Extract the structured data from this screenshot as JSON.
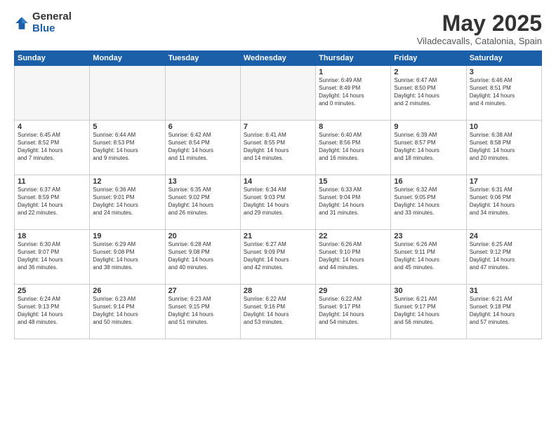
{
  "logo": {
    "general": "General",
    "blue": "Blue"
  },
  "title": "May 2025",
  "subtitle": "Viladecavalls, Catalonia, Spain",
  "days_header": [
    "Sunday",
    "Monday",
    "Tuesday",
    "Wednesday",
    "Thursday",
    "Friday",
    "Saturday"
  ],
  "weeks": [
    [
      {
        "num": "",
        "info": ""
      },
      {
        "num": "",
        "info": ""
      },
      {
        "num": "",
        "info": ""
      },
      {
        "num": "",
        "info": ""
      },
      {
        "num": "1",
        "info": "Sunrise: 6:49 AM\nSunset: 8:49 PM\nDaylight: 14 hours\nand 0 minutes."
      },
      {
        "num": "2",
        "info": "Sunrise: 6:47 AM\nSunset: 8:50 PM\nDaylight: 14 hours\nand 2 minutes."
      },
      {
        "num": "3",
        "info": "Sunrise: 6:46 AM\nSunset: 8:51 PM\nDaylight: 14 hours\nand 4 minutes."
      }
    ],
    [
      {
        "num": "4",
        "info": "Sunrise: 6:45 AM\nSunset: 8:52 PM\nDaylight: 14 hours\nand 7 minutes."
      },
      {
        "num": "5",
        "info": "Sunrise: 6:44 AM\nSunset: 8:53 PM\nDaylight: 14 hours\nand 9 minutes."
      },
      {
        "num": "6",
        "info": "Sunrise: 6:42 AM\nSunset: 8:54 PM\nDaylight: 14 hours\nand 11 minutes."
      },
      {
        "num": "7",
        "info": "Sunrise: 6:41 AM\nSunset: 8:55 PM\nDaylight: 14 hours\nand 14 minutes."
      },
      {
        "num": "8",
        "info": "Sunrise: 6:40 AM\nSunset: 8:56 PM\nDaylight: 14 hours\nand 16 minutes."
      },
      {
        "num": "9",
        "info": "Sunrise: 6:39 AM\nSunset: 8:57 PM\nDaylight: 14 hours\nand 18 minutes."
      },
      {
        "num": "10",
        "info": "Sunrise: 6:38 AM\nSunset: 8:58 PM\nDaylight: 14 hours\nand 20 minutes."
      }
    ],
    [
      {
        "num": "11",
        "info": "Sunrise: 6:37 AM\nSunset: 8:59 PM\nDaylight: 14 hours\nand 22 minutes."
      },
      {
        "num": "12",
        "info": "Sunrise: 6:36 AM\nSunset: 9:01 PM\nDaylight: 14 hours\nand 24 minutes."
      },
      {
        "num": "13",
        "info": "Sunrise: 6:35 AM\nSunset: 9:02 PM\nDaylight: 14 hours\nand 26 minutes."
      },
      {
        "num": "14",
        "info": "Sunrise: 6:34 AM\nSunset: 9:03 PM\nDaylight: 14 hours\nand 29 minutes."
      },
      {
        "num": "15",
        "info": "Sunrise: 6:33 AM\nSunset: 9:04 PM\nDaylight: 14 hours\nand 31 minutes."
      },
      {
        "num": "16",
        "info": "Sunrise: 6:32 AM\nSunset: 9:05 PM\nDaylight: 14 hours\nand 33 minutes."
      },
      {
        "num": "17",
        "info": "Sunrise: 6:31 AM\nSunset: 9:06 PM\nDaylight: 14 hours\nand 34 minutes."
      }
    ],
    [
      {
        "num": "18",
        "info": "Sunrise: 6:30 AM\nSunset: 9:07 PM\nDaylight: 14 hours\nand 36 minutes."
      },
      {
        "num": "19",
        "info": "Sunrise: 6:29 AM\nSunset: 9:08 PM\nDaylight: 14 hours\nand 38 minutes."
      },
      {
        "num": "20",
        "info": "Sunrise: 6:28 AM\nSunset: 9:08 PM\nDaylight: 14 hours\nand 40 minutes."
      },
      {
        "num": "21",
        "info": "Sunrise: 6:27 AM\nSunset: 9:09 PM\nDaylight: 14 hours\nand 42 minutes."
      },
      {
        "num": "22",
        "info": "Sunrise: 6:26 AM\nSunset: 9:10 PM\nDaylight: 14 hours\nand 44 minutes."
      },
      {
        "num": "23",
        "info": "Sunrise: 6:26 AM\nSunset: 9:11 PM\nDaylight: 14 hours\nand 45 minutes."
      },
      {
        "num": "24",
        "info": "Sunrise: 6:25 AM\nSunset: 9:12 PM\nDaylight: 14 hours\nand 47 minutes."
      }
    ],
    [
      {
        "num": "25",
        "info": "Sunrise: 6:24 AM\nSunset: 9:13 PM\nDaylight: 14 hours\nand 48 minutes."
      },
      {
        "num": "26",
        "info": "Sunrise: 6:23 AM\nSunset: 9:14 PM\nDaylight: 14 hours\nand 50 minutes."
      },
      {
        "num": "27",
        "info": "Sunrise: 6:23 AM\nSunset: 9:15 PM\nDaylight: 14 hours\nand 51 minutes."
      },
      {
        "num": "28",
        "info": "Sunrise: 6:22 AM\nSunset: 9:16 PM\nDaylight: 14 hours\nand 53 minutes."
      },
      {
        "num": "29",
        "info": "Sunrise: 6:22 AM\nSunset: 9:17 PM\nDaylight: 14 hours\nand 54 minutes."
      },
      {
        "num": "30",
        "info": "Sunrise: 6:21 AM\nSunset: 9:17 PM\nDaylight: 14 hours\nand 56 minutes."
      },
      {
        "num": "31",
        "info": "Sunrise: 6:21 AM\nSunset: 9:18 PM\nDaylight: 14 hours\nand 57 minutes."
      }
    ]
  ]
}
